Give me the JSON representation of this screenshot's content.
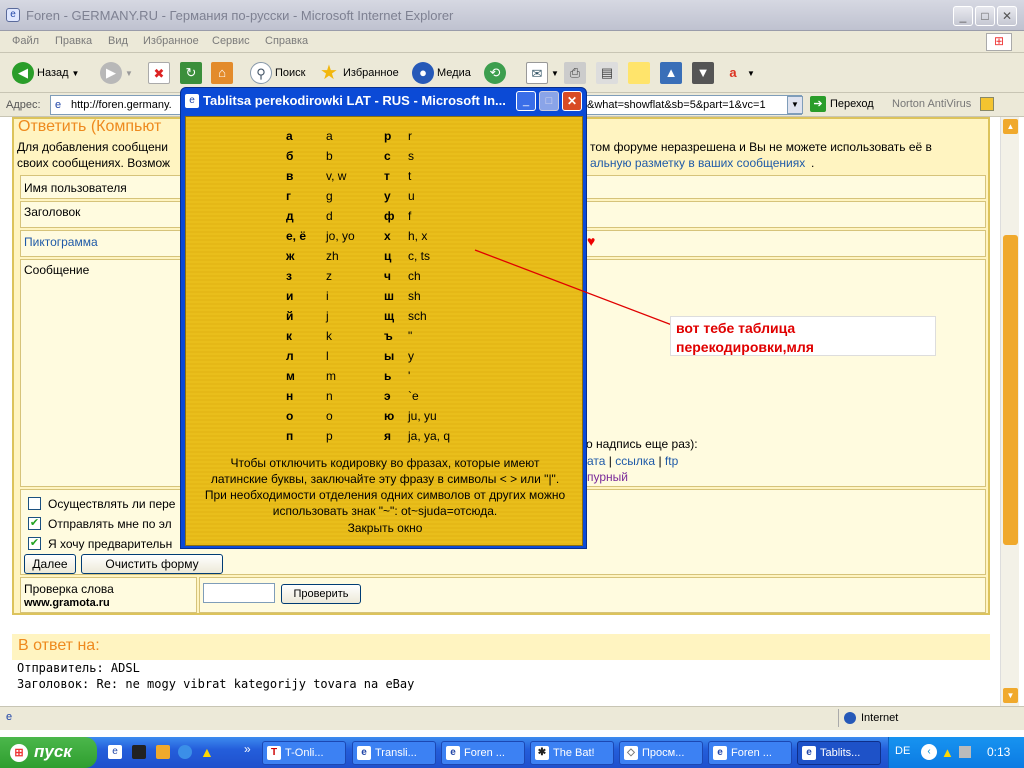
{
  "window": {
    "title": "Foren - GERMANY.RU - Германия по-русски - Microsoft Internet Explorer",
    "menu": [
      "Файл",
      "Правка",
      "Вид",
      "Избранное",
      "Сервис",
      "Справка"
    ]
  },
  "toolbar": {
    "back": "Назад",
    "search": "Поиск",
    "favorites": "Избранное",
    "media": "Медиа"
  },
  "address": {
    "label": "Адрес:",
    "url_start": "http://foren.germany.",
    "url_end": "&what=showflat&sb=5&part=1&vc=1",
    "go": "Переход",
    "norton": "Norton AntiVirus"
  },
  "form": {
    "heading": "Ответить (Компьют",
    "info_left_1": "Для добавления сообщени",
    "info_left_2": "своих сообщениях. Возмож",
    "info_right_1": "том форуме неразрешена и Вы не можете использовать её в",
    "info_right_2": "альную разметку в ваших сообщениях",
    "info_right_dot": ".",
    "username_label": "Имя пользователя",
    "subject_label": "Заголовок",
    "icon_label": "Пиктограмма",
    "heart": "♥",
    "message_label": "Сообщение",
    "hint_right": "о надпись еще раз):",
    "link_date": "ата",
    "sep": "|",
    "link_link": "ссылка",
    "link_ftp": "ftp",
    "purple_text": "пурный",
    "opt1": "Осуществлять ли пере",
    "opt2": "Отправлять мне по эл",
    "opt3": "Я хочу предварительн",
    "btn_next": "Далее",
    "btn_clear": "Очистить форму",
    "check_word_label": "Проверка слова",
    "check_word_site": "www.gramota.ru",
    "btn_check": "Проверить"
  },
  "reply": {
    "heading": "В ответ на:",
    "sender": "Отправитель: ADSL",
    "subject": "Заголовок: Re: ne mogy vibrat kategorijy tovara na eBay"
  },
  "status": {
    "zone": "Internet"
  },
  "popup": {
    "title": "Tablitsa perekodirowki LAT - RUS - Microsoft In...",
    "rows": [
      {
        "c1": "а",
        "l1": "a",
        "c2": "р",
        "l2": "r"
      },
      {
        "c1": "б",
        "l1": "b",
        "c2": "с",
        "l2": "s"
      },
      {
        "c1": "в",
        "l1": "v, w",
        "c2": "т",
        "l2": "t"
      },
      {
        "c1": "г",
        "l1": "g",
        "c2": "у",
        "l2": "u"
      },
      {
        "c1": "д",
        "l1": "d",
        "c2": "ф",
        "l2": "f"
      },
      {
        "c1": "е, ё",
        "l1": "jo, yo",
        "c2": "х",
        "l2": "h, x"
      },
      {
        "c1": "ж",
        "l1": "zh",
        "c2": "ц",
        "l2": "c, ts"
      },
      {
        "c1": "з",
        "l1": "z",
        "c2": "ч",
        "l2": "ch"
      },
      {
        "c1": "и",
        "l1": "i",
        "c2": "ш",
        "l2": "sh"
      },
      {
        "c1": "й",
        "l1": "j",
        "c2": "щ",
        "l2": "sch"
      },
      {
        "c1": "к",
        "l1": "k",
        "c2": "ъ",
        "l2": "\""
      },
      {
        "c1": "л",
        "l1": "l",
        "c2": "ы",
        "l2": "y"
      },
      {
        "c1": "м",
        "l1": "m",
        "c2": "ь",
        "l2": "'"
      },
      {
        "c1": "н",
        "l1": "n",
        "c2": "э",
        "l2": "`e"
      },
      {
        "c1": "о",
        "l1": "o",
        "c2": "ю",
        "l2": "ju, yu"
      },
      {
        "c1": "п",
        "l1": "p",
        "c2": "я",
        "l2": "ja, ya, q"
      }
    ],
    "note": "Чтобы отключить кодировку во фразах, которые имеют латинские буквы, заключайте эту фразу в символы <   > или \"|\". При необходимости отделения одних символов от других можно использовать знак \"~\": ot~sjuda=отсюда.",
    "close": "Закрыть окно"
  },
  "annotation": {
    "line1": "вот тебе таблица",
    "line2": "перекодировки,мля"
  },
  "taskbar": {
    "start": "пуск",
    "tasks": [
      "T-Onli...",
      "Transli...",
      "Foren ...",
      "The Bat!",
      "Просм...",
      "Foren ...",
      "Tablits..."
    ],
    "lang": "DE",
    "clock": "0:13"
  }
}
